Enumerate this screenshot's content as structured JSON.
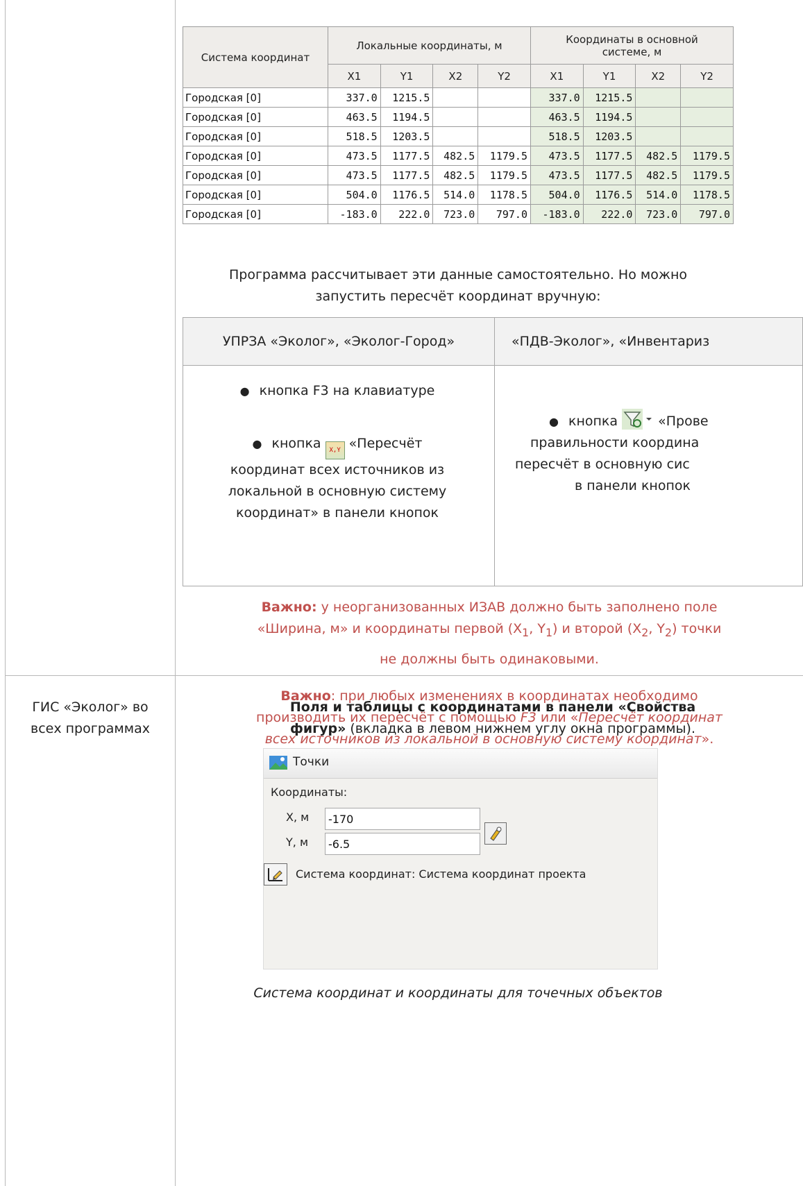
{
  "coord_table": {
    "col_system": "Система координат",
    "group_local": "Локальные координаты, м",
    "group_main": "Координаты в основной системе, м",
    "sub_headers": [
      "X1",
      "Y1",
      "X2",
      "Y2",
      "X1",
      "Y1",
      "X2",
      "Y2"
    ],
    "rows": [
      {
        "name": "Городская [0]",
        "values": [
          "337.0",
          "1215.5",
          "",
          "",
          "337.0",
          "1215.5",
          "",
          ""
        ]
      },
      {
        "name": "Городская [0]",
        "values": [
          "463.5",
          "1194.5",
          "",
          "",
          "463.5",
          "1194.5",
          "",
          ""
        ]
      },
      {
        "name": "Городская [0]",
        "values": [
          "518.5",
          "1203.5",
          "",
          "",
          "518.5",
          "1203.5",
          "",
          ""
        ]
      },
      {
        "name": "Городская [0]",
        "values": [
          "473.5",
          "1177.5",
          "482.5",
          "1179.5",
          "473.5",
          "1177.5",
          "482.5",
          "1179.5"
        ]
      },
      {
        "name": "Городская [0]",
        "values": [
          "473.5",
          "1177.5",
          "482.5",
          "1179.5",
          "473.5",
          "1177.5",
          "482.5",
          "1179.5"
        ]
      },
      {
        "name": "Городская [0]",
        "values": [
          "504.0",
          "1176.5",
          "514.0",
          "1178.5",
          "504.0",
          "1176.5",
          "514.0",
          "1178.5"
        ]
      },
      {
        "name": "Городская [0]",
        "values": [
          "-183.0",
          "222.0",
          "723.0",
          "797.0",
          "-183.0",
          "222.0",
          "723.0",
          "797.0"
        ]
      }
    ]
  },
  "intro": {
    "line1": "Программа рассчитывает эти данные самостоятельно. Но можно",
    "line2": "запустить пересчёт координат вручную:"
  },
  "buttons_table": {
    "left_header": "УПРЗА «Эколог», «Эколог-Город»",
    "right_header": "«ПДВ-Эколог», «Инвентариз",
    "left_item1": "кнопка F3 на клавиатуре",
    "left_item2_prefix": "кнопка",
    "left_item2_l1": "«Пересчёт",
    "left_item2_l2": "координат всех источников из",
    "left_item2_l3": "локальной в основную систему",
    "left_item2_l4": "координат» в панели кнопок",
    "right_item_prefix": "кнопка",
    "right_item_l1": "«Прове",
    "right_item_l2": "правильности координа",
    "right_item_l3": "пересчёт в основную сис",
    "right_item_l4": "в панели кнопок"
  },
  "warning1": {
    "bold": "Важно:",
    "l1": " у неорганизованных ИЗАВ должно быть заполнено поле",
    "l2a": "«Ширина, м» и координаты первой (X",
    "s1": "1",
    "l2b": ", Y",
    "s2": "1",
    "l2c": ") и второй (X",
    "s3": "2",
    "l2d": ", Y",
    "s4": "2",
    "l2e": ") точки",
    "l3": "не должны быть одинаковыми."
  },
  "warning2": {
    "bold": "Важно",
    "l1": ": при любых изменениях в координатах необходимо",
    "l2a": "производить их пересчёт с помощью ",
    "f3": "F3",
    "l2b": " или «",
    "l2c": "Пересчёт координат",
    "l3a": "всех источников из локальной в основную систему координат",
    "l3b": "»."
  },
  "gis_row": {
    "left_l1": "ГИС «Эколог» во",
    "left_l2": "всех программах",
    "heading_bold1": "Поля и таблицы с координатами в панели «Свойства",
    "heading_bold2": "фигур»",
    "heading_rest": " (вкладка в левом нижнем углу окна программы).",
    "caption": "Система координат и координаты для точечных объектов"
  },
  "panel": {
    "title": "Точки",
    "coords_label": "Координаты:",
    "x_label": "X, м",
    "x_value": "-170",
    "y_label": "Y, м",
    "y_value": "-6.5",
    "system_label": "Система координат:",
    "system_value": "Система координат проекта"
  }
}
